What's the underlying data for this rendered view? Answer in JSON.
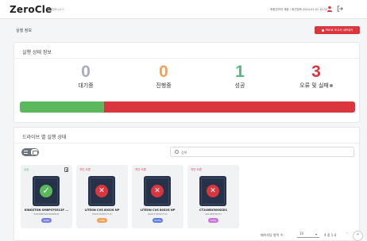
{
  "header": {
    "logo": "ZeroCle",
    "version": "버전정보 v2.0",
    "user_info": "최종관리자 계정 / 최근접속 2024.01.01 10:12",
    "user_icon": "user-icon",
    "logout_icon": "logout-icon"
  },
  "page": {
    "title": "실행 정보",
    "pdf_button_label": "PDF로 보고서 내보내기"
  },
  "status_card": {
    "title": "실행 상태 정보",
    "stats": [
      {
        "value": "0",
        "label": "대기중",
        "color": "#a7abc3"
      },
      {
        "value": "0",
        "label": "진행중",
        "color": "#f0a25a"
      },
      {
        "value": "1",
        "label": "성공",
        "color": "#5cb57e"
      },
      {
        "value": "3",
        "label": "오류 및 실패",
        "color": "#d9363e"
      }
    ],
    "progress": {
      "success_fraction": 0.25,
      "fail_fraction": 0.75
    }
  },
  "drives_card": {
    "title": "드라이브 별 실행 상태",
    "search_placeholder": "검색",
    "drives": [
      {
        "status": "성공",
        "state": "ok",
        "model": "KINGSTON SM8PCP3512F ...",
        "serial": "50026B7682D0D9D0",
        "tag": "SATA",
        "tag_color": "#7b7fe0"
      },
      {
        "status": "지단 오류",
        "state": "fail",
        "model": "LITEON CVS 8032G NP",
        "serial": "0021153627711",
        "tag": "USB",
        "tag_color": "#f0a25a"
      },
      {
        "status": "지단 오류",
        "state": "fail",
        "model": "LITEON CVS 8032G NP",
        "serial": "0021153627711",
        "tag": "NVMe",
        "tag_color": "#5b7be0"
      },
      {
        "status": "지단 오류",
        "state": "fail",
        "model": "CT240BX500SSD1",
        "serial": "2012E4F8C57",
        "tag": "SATA",
        "tag_color": "#c774d9"
      }
    ],
    "pager": {
      "per_page_label": "페이지당 항목 수:",
      "per_page_value": "10",
      "range": "4 중 1-4",
      "prev_icon": "‹",
      "next_icon": "›"
    }
  },
  "fab_icon": "⌃"
}
